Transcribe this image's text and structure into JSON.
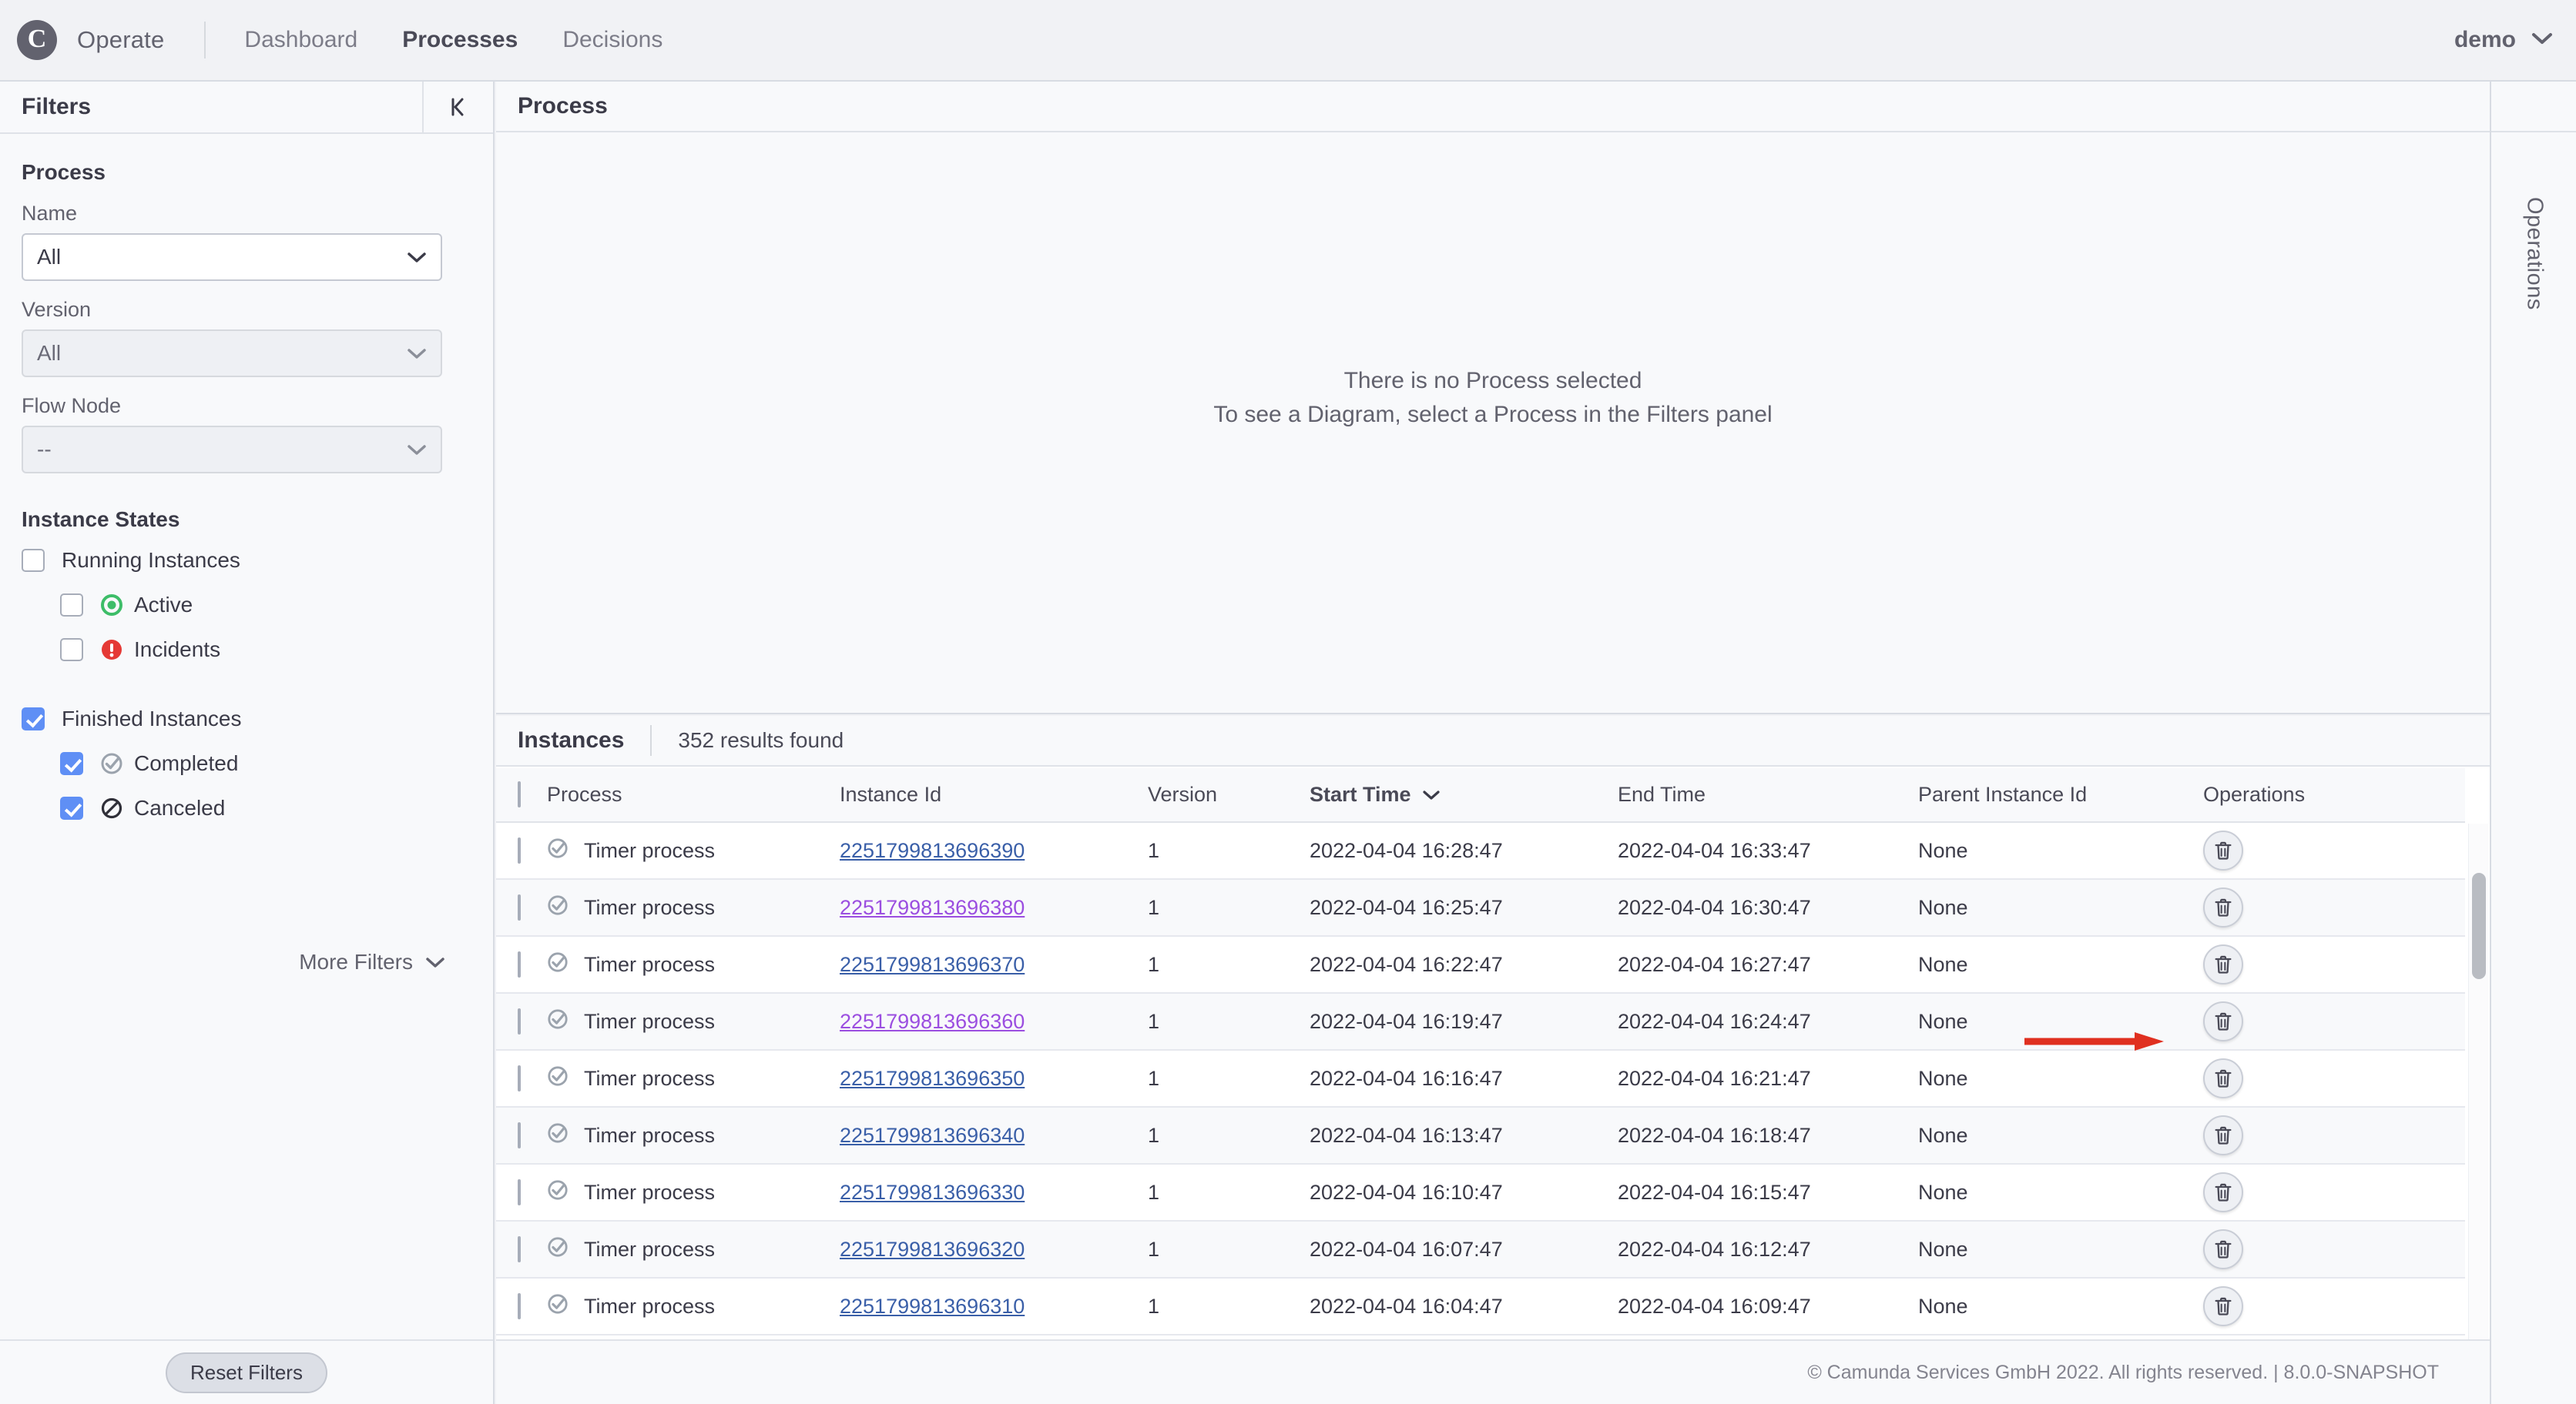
{
  "header": {
    "brand": "Operate",
    "logo_icon": "camunda-logo-icon",
    "nav": [
      {
        "label": "Dashboard",
        "active": false
      },
      {
        "label": "Processes",
        "active": true
      },
      {
        "label": "Decisions",
        "active": false
      }
    ],
    "user": "demo",
    "user_chevron_icon": "chevron-down-icon"
  },
  "filters": {
    "title": "Filters",
    "collapse_icon": "panel-collapse-left-icon",
    "process_section": "Process",
    "name_label": "Name",
    "name_value": "All",
    "version_label": "Version",
    "version_value": "All",
    "flow_node_label": "Flow Node",
    "flow_node_value": "--",
    "instance_states_title": "Instance States",
    "running_instances": "Running Instances",
    "active": "Active",
    "incidents": "Incidents",
    "finished_instances": "Finished Instances",
    "completed": "Completed",
    "canceled": "Canceled",
    "more_filters": "More Filters",
    "more_filters_icon": "chevron-down-icon",
    "reset_filters": "Reset Filters",
    "checked": {
      "running_instances": false,
      "active": false,
      "incidents": false,
      "finished_instances": true,
      "completed": true,
      "canceled": true
    },
    "colors": {
      "active": "#3dbd68",
      "incident": "#e53935",
      "completed": "#9ba3ad",
      "canceled": "#2f2f38",
      "checkbox_checked": "#5f8ff5"
    }
  },
  "diagram": {
    "panel_title": "Process",
    "empty_line1": "There is no Process selected",
    "empty_line2": "To see a Diagram, select a Process in the Filters panel"
  },
  "instances": {
    "title": "Instances",
    "results_found": "352 results found",
    "columns": [
      "Process",
      "Instance Id",
      "Version",
      "Start Time",
      "End Time",
      "Parent Instance Id",
      "Operations"
    ],
    "sort_column": "Start Time",
    "sort_icon": "chevron-down-icon",
    "header_checkbox_checked": false,
    "delete_icon": "trash-icon",
    "state_icon": "completed-check-icon",
    "rows": [
      {
        "process": "Timer process",
        "id": "2251799813696390",
        "version": "1",
        "start": "2022-04-04 16:28:47",
        "end": "2022-04-04 16:33:47",
        "parent": "None",
        "visited": false
      },
      {
        "process": "Timer process",
        "id": "2251799813696380",
        "version": "1",
        "start": "2022-04-04 16:25:47",
        "end": "2022-04-04 16:30:47",
        "parent": "None",
        "visited": true
      },
      {
        "process": "Timer process",
        "id": "2251799813696370",
        "version": "1",
        "start": "2022-04-04 16:22:47",
        "end": "2022-04-04 16:27:47",
        "parent": "None",
        "visited": false
      },
      {
        "process": "Timer process",
        "id": "2251799813696360",
        "version": "1",
        "start": "2022-04-04 16:19:47",
        "end": "2022-04-04 16:24:47",
        "parent": "None",
        "visited": true
      },
      {
        "process": "Timer process",
        "id": "2251799813696350",
        "version": "1",
        "start": "2022-04-04 16:16:47",
        "end": "2022-04-04 16:21:47",
        "parent": "None",
        "visited": false
      },
      {
        "process": "Timer process",
        "id": "2251799813696340",
        "version": "1",
        "start": "2022-04-04 16:13:47",
        "end": "2022-04-04 16:18:47",
        "parent": "None",
        "visited": false
      },
      {
        "process": "Timer process",
        "id": "2251799813696330",
        "version": "1",
        "start": "2022-04-04 16:10:47",
        "end": "2022-04-04 16:15:47",
        "parent": "None",
        "visited": false
      },
      {
        "process": "Timer process",
        "id": "2251799813696320",
        "version": "1",
        "start": "2022-04-04 16:07:47",
        "end": "2022-04-04 16:12:47",
        "parent": "None",
        "visited": false
      },
      {
        "process": "Timer process",
        "id": "2251799813696310",
        "version": "1",
        "start": "2022-04-04 16:04:47",
        "end": "2022-04-04 16:09:47",
        "parent": "None",
        "visited": false
      }
    ]
  },
  "operations_panel": {
    "label": "Operations"
  },
  "annotation": {
    "arrow_color": "#e03020",
    "points_to": "delete-operation-button-row-1"
  },
  "footer": {
    "text": "© Camunda Services GmbH 2022. All rights reserved. | 8.0.0-SNAPSHOT"
  }
}
